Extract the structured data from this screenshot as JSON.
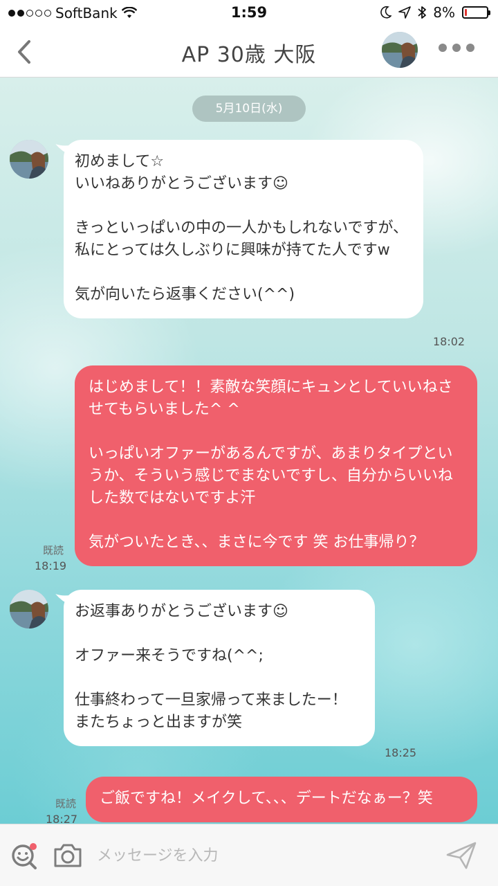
{
  "status_bar": {
    "carrier": "SoftBank",
    "time": "1:59",
    "battery_percent": "8%",
    "battery_level": 0.08,
    "battery_color": "#e0332f"
  },
  "header": {
    "title": "AP 30歳 大阪",
    "back_icon": "chevron-left-icon",
    "more_icon": "ellipsis-icon"
  },
  "chat": {
    "date": "5月10日(水)",
    "messages": [
      {
        "direction": "in",
        "text": "初めまして☆\nいいねありがとうございます☺\n\nきっといっぱいの中の一人かもしれないですが、私にとっては久しぶりに興味が持てた人ですw\n\n気が向いたら返事ください(^^)",
        "time": "18:02"
      },
      {
        "direction": "out",
        "text": "はじめまして！！素敵な笑顔にキュンとしていいねさせてもらいました^ ^\n\nいっぱいオファーがあるんですが、あまりタイプというか、そういう感じでまないですし、自分からいいねした数ではないですよ汗\n\n気がついたとき、、まさに今です 笑 お仕事帰り？",
        "read": "既読",
        "time": "18:19"
      },
      {
        "direction": "in",
        "text": "お返事ありがとうございます☺\n\nオファー来そうですね(^^;\n\n仕事終わって一旦家帰って来ましたー！\nまたちょっと出ますが笑",
        "time": "18:25"
      },
      {
        "direction": "out",
        "text": "ご飯ですね！メイクして、、、デートだなぁー？笑",
        "read": "既読",
        "time": "18:27"
      }
    ]
  },
  "input_bar": {
    "placeholder": "メッセージを入力",
    "value": "",
    "accent_color": "#f0606c"
  },
  "colors": {
    "outgoing_bubble": "#f0606c",
    "incoming_bubble": "#ffffff",
    "date_pill": "#aec4c1"
  }
}
